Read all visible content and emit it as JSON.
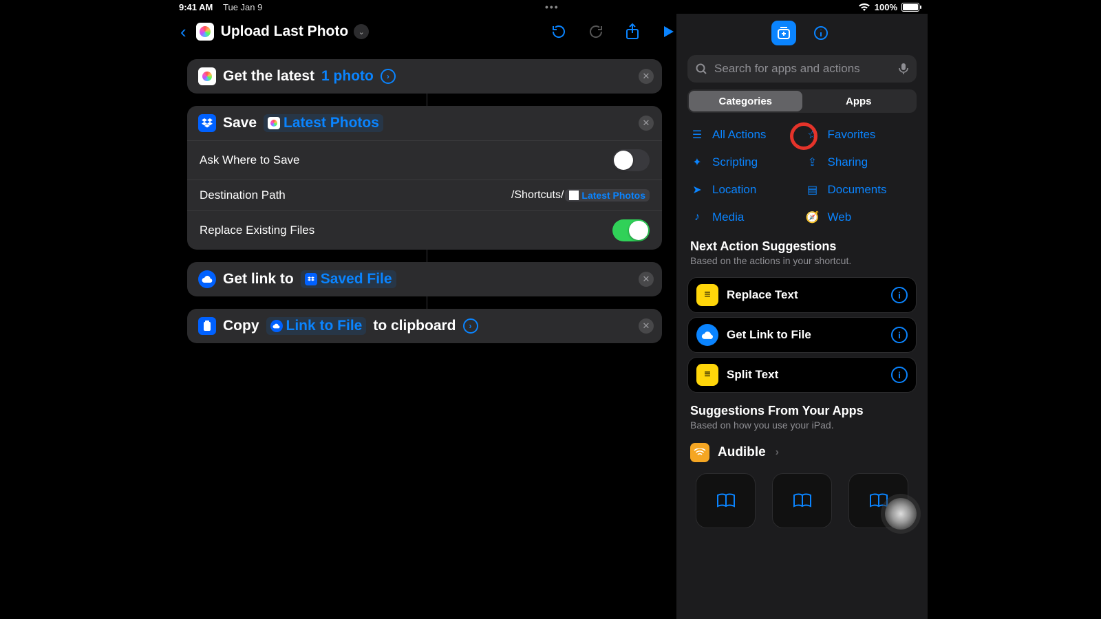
{
  "status": {
    "time": "9:41 AM",
    "date": "Tue Jan 9",
    "battery": "100%"
  },
  "header": {
    "title": "Upload Last Photo"
  },
  "actions": [
    {
      "prefix": "Get the latest",
      "token": "1 photo"
    },
    {
      "prefix": "Save",
      "token": "Latest Photos",
      "rows": {
        "ask_label": "Ask Where to Save",
        "ask_on": false,
        "dest_label": "Destination Path",
        "dest_prefix": "/Shortcuts/",
        "dest_token": "Latest Photos",
        "replace_label": "Replace Existing Files",
        "replace_on": true
      }
    },
    {
      "prefix": "Get link to",
      "token": "Saved File"
    },
    {
      "prefix": "Copy",
      "token": "Link to File",
      "suffix": "to clipboard"
    }
  ],
  "panel": {
    "search_placeholder": "Search for apps and actions",
    "seg": {
      "a": "Categories",
      "b": "Apps"
    },
    "categories": [
      "All Actions",
      "Favorites",
      "Scripting",
      "Sharing",
      "Location",
      "Documents",
      "Media",
      "Web"
    ],
    "next_h": "Next Action Suggestions",
    "next_sub": "Based on the actions in your shortcut.",
    "suggestions": [
      {
        "label": "Replace Text",
        "color": "yellow"
      },
      {
        "label": "Get Link to File",
        "color": "blue"
      },
      {
        "label": "Split Text",
        "color": "yellow"
      }
    ],
    "apps_h": "Suggestions From Your Apps",
    "apps_sub": "Based on how you use your iPad.",
    "app_name": "Audible"
  }
}
